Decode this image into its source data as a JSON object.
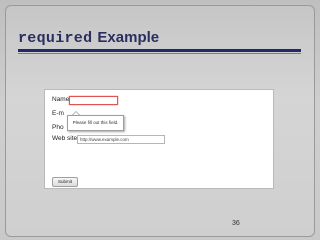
{
  "slide": {
    "title_code": "required",
    "title_word": "Example",
    "page_number": "36"
  },
  "form": {
    "name_label": "Name:",
    "email_label": "E-m",
    "phone_label": "Pho",
    "website_label": "Web site:",
    "website_value": "http://www.example.com",
    "submit_label": "Submit",
    "validation_message": "Please fill out this field."
  },
  "colors": {
    "title": "#2b2f5f",
    "rule": "#1f2a66",
    "invalid_border": "#e15353"
  }
}
